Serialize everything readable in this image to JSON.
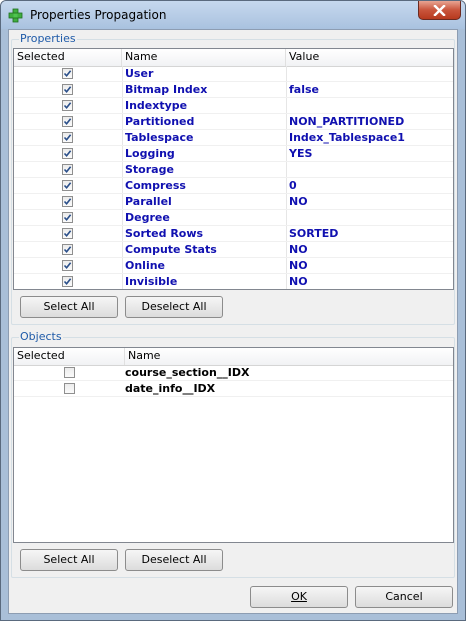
{
  "window": {
    "title": "Properties Propagation",
    "icon": "green-cross-icon"
  },
  "properties": {
    "group_label": "Properties",
    "columns": [
      "Selected",
      "Name",
      "Value"
    ],
    "rows": [
      {
        "checked": true,
        "name": "User",
        "value": ""
      },
      {
        "checked": true,
        "name": "Bitmap Index",
        "value": "false"
      },
      {
        "checked": true,
        "name": "Indextype",
        "value": ""
      },
      {
        "checked": true,
        "name": "Partitioned",
        "value": "NON_PARTITIONED"
      },
      {
        "checked": true,
        "name": "Tablespace",
        "value": "Index_Tablespace1"
      },
      {
        "checked": true,
        "name": "Logging",
        "value": "YES"
      },
      {
        "checked": true,
        "name": "Storage",
        "value": ""
      },
      {
        "checked": true,
        "name": "Compress",
        "value": "0"
      },
      {
        "checked": true,
        "name": "Parallel",
        "value": "NO"
      },
      {
        "checked": true,
        "name": "Degree",
        "value": ""
      },
      {
        "checked": true,
        "name": "Sorted Rows",
        "value": "SORTED"
      },
      {
        "checked": true,
        "name": "Compute Stats",
        "value": "NO"
      },
      {
        "checked": true,
        "name": "Online",
        "value": "NO"
      },
      {
        "checked": true,
        "name": "Invisible",
        "value": "NO"
      }
    ],
    "select_all": "Select All",
    "deselect_all": "Deselect All"
  },
  "objects": {
    "group_label": "Objects",
    "columns": [
      "Selected",
      "Name"
    ],
    "rows": [
      {
        "checked": false,
        "name": "course_section__IDX"
      },
      {
        "checked": false,
        "name": "date_info__IDX"
      }
    ],
    "select_all": "Select All",
    "deselect_all": "Deselect All"
  },
  "footer": {
    "ok": "OK",
    "cancel": "Cancel"
  },
  "colors": {
    "value_text": "#1010b0",
    "group_label": "#1e5aa8"
  }
}
